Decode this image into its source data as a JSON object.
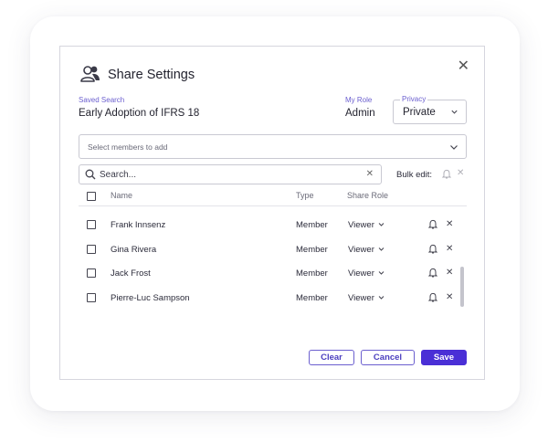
{
  "dialog": {
    "title": "Share Settings",
    "close_symbol": "✕",
    "header_icon": "users-icon"
  },
  "saved_search": {
    "label": "Saved Search",
    "value": "Early Adoption of IFRS 18"
  },
  "my_role": {
    "label": "My Role",
    "value": "Admin"
  },
  "privacy": {
    "label": "Privacy",
    "value": "Private"
  },
  "members_select": {
    "placeholder": "Select members to add"
  },
  "search": {
    "placeholder": "Search...",
    "clear_symbol": "✕"
  },
  "bulk_edit": {
    "label": "Bulk edit:",
    "clear_symbol": "✕"
  },
  "table": {
    "columns": {
      "name": "Name",
      "type": "Type",
      "share_role": "Share Role"
    },
    "rows": [
      {
        "name": "Frank Innsenz",
        "type": "Member",
        "role": "Viewer"
      },
      {
        "name": "Gina Rivera",
        "type": "Member",
        "role": "Viewer"
      },
      {
        "name": "Jack Frost",
        "type": "Member",
        "role": "Viewer"
      },
      {
        "name": "Pierre-Luc Sampson",
        "type": "Member",
        "role": "Viewer"
      }
    ],
    "remove_symbol": "✕"
  },
  "footer": {
    "clear_label": "Clear",
    "cancel_label": "Cancel",
    "save_label": "Save"
  },
  "colors": {
    "accent": "#4a2fd6",
    "accent_text": "#6b5fcf",
    "border": "#c9c9d2"
  }
}
